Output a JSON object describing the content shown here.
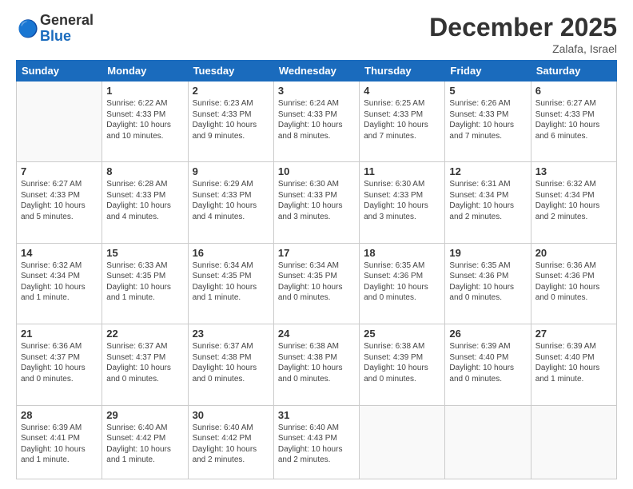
{
  "logo": {
    "text_general": "General",
    "text_blue": "Blue"
  },
  "header": {
    "month": "December 2025",
    "location": "Zalafa, Israel"
  },
  "weekdays": [
    "Sunday",
    "Monday",
    "Tuesday",
    "Wednesday",
    "Thursday",
    "Friday",
    "Saturday"
  ],
  "weeks": [
    [
      {
        "day": "",
        "info": ""
      },
      {
        "day": "1",
        "info": "Sunrise: 6:22 AM\nSunset: 4:33 PM\nDaylight: 10 hours\nand 10 minutes."
      },
      {
        "day": "2",
        "info": "Sunrise: 6:23 AM\nSunset: 4:33 PM\nDaylight: 10 hours\nand 9 minutes."
      },
      {
        "day": "3",
        "info": "Sunrise: 6:24 AM\nSunset: 4:33 PM\nDaylight: 10 hours\nand 8 minutes."
      },
      {
        "day": "4",
        "info": "Sunrise: 6:25 AM\nSunset: 4:33 PM\nDaylight: 10 hours\nand 7 minutes."
      },
      {
        "day": "5",
        "info": "Sunrise: 6:26 AM\nSunset: 4:33 PM\nDaylight: 10 hours\nand 7 minutes."
      },
      {
        "day": "6",
        "info": "Sunrise: 6:27 AM\nSunset: 4:33 PM\nDaylight: 10 hours\nand 6 minutes."
      }
    ],
    [
      {
        "day": "7",
        "info": "Sunrise: 6:27 AM\nSunset: 4:33 PM\nDaylight: 10 hours\nand 5 minutes."
      },
      {
        "day": "8",
        "info": "Sunrise: 6:28 AM\nSunset: 4:33 PM\nDaylight: 10 hours\nand 4 minutes."
      },
      {
        "day": "9",
        "info": "Sunrise: 6:29 AM\nSunset: 4:33 PM\nDaylight: 10 hours\nand 4 minutes."
      },
      {
        "day": "10",
        "info": "Sunrise: 6:30 AM\nSunset: 4:33 PM\nDaylight: 10 hours\nand 3 minutes."
      },
      {
        "day": "11",
        "info": "Sunrise: 6:30 AM\nSunset: 4:33 PM\nDaylight: 10 hours\nand 3 minutes."
      },
      {
        "day": "12",
        "info": "Sunrise: 6:31 AM\nSunset: 4:34 PM\nDaylight: 10 hours\nand 2 minutes."
      },
      {
        "day": "13",
        "info": "Sunrise: 6:32 AM\nSunset: 4:34 PM\nDaylight: 10 hours\nand 2 minutes."
      }
    ],
    [
      {
        "day": "14",
        "info": "Sunrise: 6:32 AM\nSunset: 4:34 PM\nDaylight: 10 hours\nand 1 minute."
      },
      {
        "day": "15",
        "info": "Sunrise: 6:33 AM\nSunset: 4:35 PM\nDaylight: 10 hours\nand 1 minute."
      },
      {
        "day": "16",
        "info": "Sunrise: 6:34 AM\nSunset: 4:35 PM\nDaylight: 10 hours\nand 1 minute."
      },
      {
        "day": "17",
        "info": "Sunrise: 6:34 AM\nSunset: 4:35 PM\nDaylight: 10 hours\nand 0 minutes."
      },
      {
        "day": "18",
        "info": "Sunrise: 6:35 AM\nSunset: 4:36 PM\nDaylight: 10 hours\nand 0 minutes."
      },
      {
        "day": "19",
        "info": "Sunrise: 6:35 AM\nSunset: 4:36 PM\nDaylight: 10 hours\nand 0 minutes."
      },
      {
        "day": "20",
        "info": "Sunrise: 6:36 AM\nSunset: 4:36 PM\nDaylight: 10 hours\nand 0 minutes."
      }
    ],
    [
      {
        "day": "21",
        "info": "Sunrise: 6:36 AM\nSunset: 4:37 PM\nDaylight: 10 hours\nand 0 minutes."
      },
      {
        "day": "22",
        "info": "Sunrise: 6:37 AM\nSunset: 4:37 PM\nDaylight: 10 hours\nand 0 minutes."
      },
      {
        "day": "23",
        "info": "Sunrise: 6:37 AM\nSunset: 4:38 PM\nDaylight: 10 hours\nand 0 minutes."
      },
      {
        "day": "24",
        "info": "Sunrise: 6:38 AM\nSunset: 4:38 PM\nDaylight: 10 hours\nand 0 minutes."
      },
      {
        "day": "25",
        "info": "Sunrise: 6:38 AM\nSunset: 4:39 PM\nDaylight: 10 hours\nand 0 minutes."
      },
      {
        "day": "26",
        "info": "Sunrise: 6:39 AM\nSunset: 4:40 PM\nDaylight: 10 hours\nand 0 minutes."
      },
      {
        "day": "27",
        "info": "Sunrise: 6:39 AM\nSunset: 4:40 PM\nDaylight: 10 hours\nand 1 minute."
      }
    ],
    [
      {
        "day": "28",
        "info": "Sunrise: 6:39 AM\nSunset: 4:41 PM\nDaylight: 10 hours\nand 1 minute."
      },
      {
        "day": "29",
        "info": "Sunrise: 6:40 AM\nSunset: 4:42 PM\nDaylight: 10 hours\nand 1 minute."
      },
      {
        "day": "30",
        "info": "Sunrise: 6:40 AM\nSunset: 4:42 PM\nDaylight: 10 hours\nand 2 minutes."
      },
      {
        "day": "31",
        "info": "Sunrise: 6:40 AM\nSunset: 4:43 PM\nDaylight: 10 hours\nand 2 minutes."
      },
      {
        "day": "",
        "info": ""
      },
      {
        "day": "",
        "info": ""
      },
      {
        "day": "",
        "info": ""
      }
    ]
  ]
}
